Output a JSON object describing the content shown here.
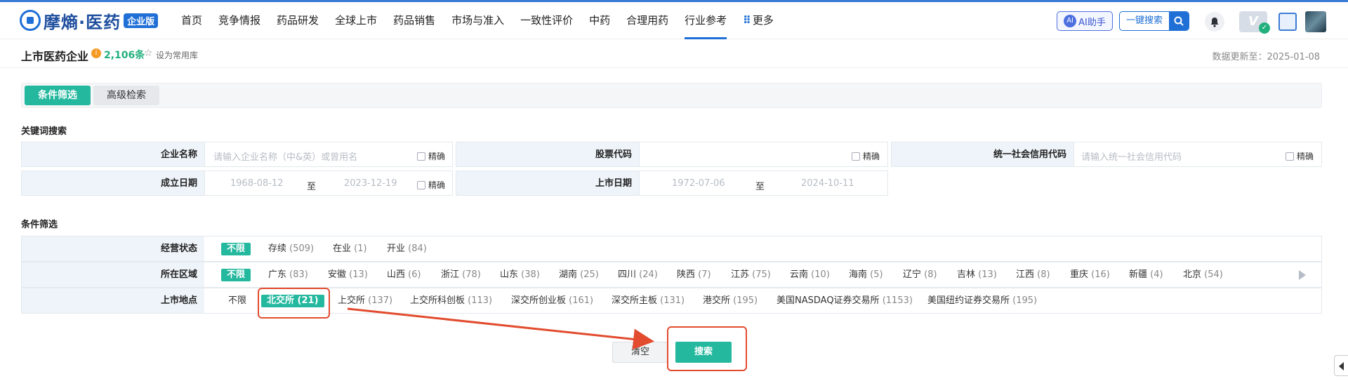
{
  "header": {
    "logo_text": "摩熵·医药",
    "logo_badge": "企业版",
    "nav": [
      "首页",
      "竞争情报",
      "药品研发",
      "全球上市",
      "药品销售",
      "市场与准入",
      "一致性评价",
      "中药",
      "合理用药",
      "行业参考",
      "更多"
    ],
    "active_nav": "行业参考",
    "ai_label": "AI助手",
    "ai_icon_text": "AI",
    "search_label": "一键搜索"
  },
  "subhead": {
    "title": "上市医药企业",
    "count": "2,106条",
    "favorite_label": "设为常用库",
    "update_label": "数据更新至：2025-01-08"
  },
  "tabs": {
    "active": "条件筛选",
    "other": "高级检索"
  },
  "keyword_section": {
    "title": "关键词搜索",
    "company_name_label": "企业名称",
    "company_name_placeholder": "请输入企业名称（中&英）或曾用名",
    "stock_code_label": "股票代码",
    "credit_code_label": "统一社会信用代码",
    "credit_code_placeholder": "请输入统一社会信用代码",
    "exact_label": "精确",
    "found_date_label": "成立日期",
    "found_from": "1968-08-12",
    "found_to": "2023-12-19",
    "listing_date_label": "上市日期",
    "listing_from": "1972-07-06",
    "listing_to": "2024-10-11",
    "to_label": "至"
  },
  "filter_section": {
    "title": "条件筛选",
    "status": {
      "label": "经营状态",
      "options": [
        {
          "name": "不限",
          "count": ""
        },
        {
          "name": "存续",
          "count": "(509)"
        },
        {
          "name": "在业",
          "count": "(1)"
        },
        {
          "name": "开业",
          "count": "(84)"
        }
      ]
    },
    "region": {
      "label": "所在区域",
      "options": [
        {
          "name": "不限",
          "count": ""
        },
        {
          "name": "广东",
          "count": "(83)"
        },
        {
          "name": "安徽",
          "count": "(13)"
        },
        {
          "name": "山西",
          "count": "(6)"
        },
        {
          "name": "浙江",
          "count": "(78)"
        },
        {
          "name": "山东",
          "count": "(38)"
        },
        {
          "name": "湖南",
          "count": "(25)"
        },
        {
          "name": "四川",
          "count": "(24)"
        },
        {
          "name": "陕西",
          "count": "(7)"
        },
        {
          "name": "江苏",
          "count": "(75)"
        },
        {
          "name": "云南",
          "count": "(10)"
        },
        {
          "name": "海南",
          "count": "(5)"
        },
        {
          "name": "辽宁",
          "count": "(8)"
        },
        {
          "name": "吉林",
          "count": "(13)"
        },
        {
          "name": "江西",
          "count": "(8)"
        },
        {
          "name": "重庆",
          "count": "(16)"
        },
        {
          "name": "新疆",
          "count": "(4)"
        },
        {
          "name": "北京",
          "count": "(54)"
        }
      ]
    },
    "exchange": {
      "label": "上市地点",
      "options": [
        {
          "name": "不限",
          "count": ""
        },
        {
          "name": "北交所",
          "count": "(21)"
        },
        {
          "name": "上交所",
          "count": "(137)"
        },
        {
          "name": "上交所科创板",
          "count": "(113)"
        },
        {
          "name": "深交所创业板",
          "count": "(161)"
        },
        {
          "name": "深交所主板",
          "count": "(131)"
        },
        {
          "name": "港交所",
          "count": "(195)"
        },
        {
          "name": "美国NASDAQ证券交易所",
          "count": "(1153)"
        },
        {
          "name": "美国纽约证券交易所",
          "count": "(195)"
        }
      ]
    }
  },
  "actions": {
    "clear": "清空",
    "search": "搜索"
  },
  "colors": {
    "accent": "#24b89e",
    "brand": "#1f6fd6",
    "annotation": "#e24b2e"
  }
}
